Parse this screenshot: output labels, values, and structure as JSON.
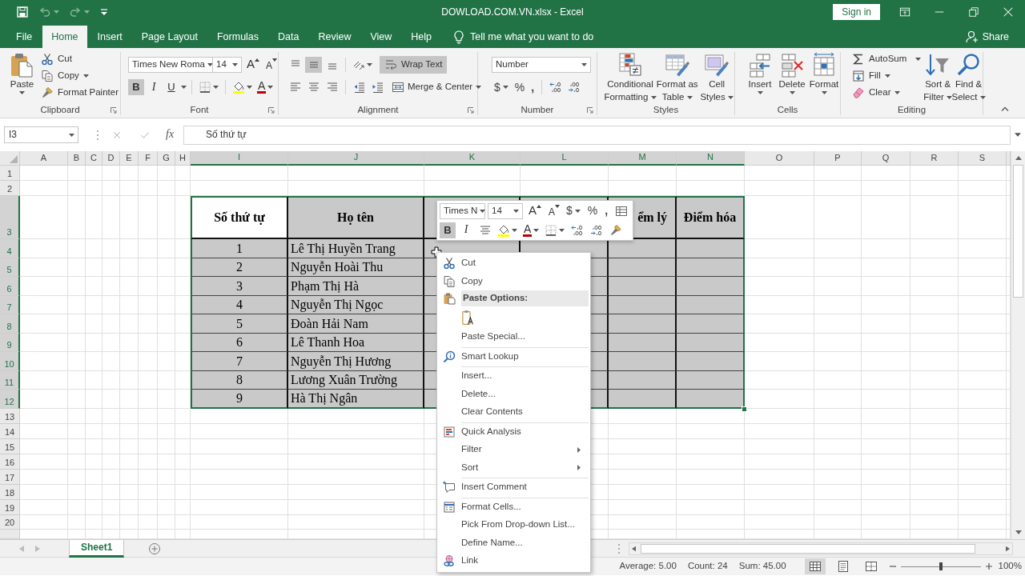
{
  "title_bar": {
    "quick_access": [
      {
        "disabled": false
      },
      {
        "disabled": true
      },
      {
        "disabled": true
      }
    ],
    "title": "DOWLOAD.COM.VN.xlsx - Excel",
    "sign_in": "Sign in"
  },
  "ribbon_tabs": [
    {
      "label": "File",
      "selected": false
    },
    {
      "label": "Home",
      "selected": true
    },
    {
      "label": "Insert",
      "selected": false
    },
    {
      "label": "Page Layout",
      "selected": false
    },
    {
      "label": "Formulas",
      "selected": false
    },
    {
      "label": "Data",
      "selected": false
    },
    {
      "label": "Review",
      "selected": false
    },
    {
      "label": "View",
      "selected": false
    },
    {
      "label": "Help",
      "selected": false
    }
  ],
  "tell_me": "Tell me what you want to do",
  "share": "Share",
  "ribbon": {
    "clipboard": {
      "label": "Clipboard",
      "paste": "Paste",
      "cut": "Cut",
      "copy": "Copy",
      "format_painter": "Format Painter"
    },
    "font": {
      "label": "Font",
      "font_name": "Times New Roma",
      "font_size": "14",
      "grow": "A",
      "shrink": "A",
      "styles": [
        {
          "label": "B",
          "selected": true
        },
        {
          "label": "I",
          "selected": false
        },
        {
          "label": "U",
          "selected": false
        }
      ],
      "font_color": "A"
    },
    "alignment": {
      "label": "Alignment",
      "vertical": [
        {
          "selected": false
        },
        {
          "selected": true
        },
        {
          "selected": false
        }
      ],
      "wrap_text": {
        "label": "Wrap Text",
        "selected": true
      },
      "horizontal": [
        {
          "selected": false
        },
        {
          "selected": false
        },
        {
          "selected": false
        }
      ],
      "merge": "Merge & Center"
    },
    "number": {
      "label": "Number",
      "format": "Number",
      "currency": "$",
      "percent": "%",
      "comma": ","
    },
    "styles": {
      "label": "Styles",
      "buttons": [
        [
          "Conditional",
          "Formatting"
        ],
        [
          "Format as",
          "Table"
        ],
        [
          "Cell",
          "Styles"
        ]
      ]
    },
    "cells": {
      "label": "Cells",
      "buttons": [
        "Insert",
        "Delete",
        "Format"
      ]
    },
    "editing": {
      "label": "Editing",
      "autosum": "AutoSum",
      "fill": "Fill",
      "clear": "Clear",
      "sort": [
        "Sort &",
        "Filter"
      ],
      "find": [
        "Find &",
        "Select"
      ]
    }
  },
  "formula_bar": {
    "name_box": "I3",
    "function_label": "fx",
    "formula": "Số thứ tự"
  },
  "sheet": {
    "columns": [
      {
        "label": "A",
        "selected": false
      },
      {
        "label": "B",
        "selected": false
      },
      {
        "label": "C",
        "selected": false
      },
      {
        "label": "D",
        "selected": false
      },
      {
        "label": "E",
        "selected": false
      },
      {
        "label": "F",
        "selected": false
      },
      {
        "label": "G",
        "selected": false
      },
      {
        "label": "H",
        "selected": false
      },
      {
        "label": "I",
        "selected": true
      },
      {
        "label": "J",
        "selected": true
      },
      {
        "label": "K",
        "selected": true
      },
      {
        "label": "L",
        "selected": true
      },
      {
        "label": "M",
        "selected": true
      },
      {
        "label": "N",
        "selected": true
      },
      {
        "label": "O",
        "selected": false
      },
      {
        "label": "P",
        "selected": false
      },
      {
        "label": "Q",
        "selected": false
      },
      {
        "label": "R",
        "selected": false
      },
      {
        "label": "S",
        "selected": false
      }
    ],
    "rows": [
      {
        "label": "1",
        "selected": false
      },
      {
        "label": "2",
        "selected": false
      },
      {
        "label": "3",
        "selected": true
      },
      {
        "label": "4",
        "selected": true
      },
      {
        "label": "5",
        "selected": true
      },
      {
        "label": "6",
        "selected": true
      },
      {
        "label": "7",
        "selected": true
      },
      {
        "label": "8",
        "selected": true
      },
      {
        "label": "9",
        "selected": true
      },
      {
        "label": "10",
        "selected": true
      },
      {
        "label": "11",
        "selected": true
      },
      {
        "label": "12",
        "selected": true
      },
      {
        "label": "13",
        "selected": false
      },
      {
        "label": "14",
        "selected": false
      },
      {
        "label": "15",
        "selected": false
      },
      {
        "label": "16",
        "selected": false
      },
      {
        "label": "17",
        "selected": false
      },
      {
        "label": "18",
        "selected": false
      },
      {
        "label": "19",
        "selected": false
      },
      {
        "label": "20",
        "selected": false
      }
    ]
  },
  "table": {
    "selected": true,
    "header": [
      {
        "text": "Số thứ tự",
        "active": true
      },
      {
        "text": "Họ tên",
        "active": false
      },
      {
        "active": false
      },
      {
        "active": false
      },
      {
        "text": "ểm lý",
        "active": false
      },
      {
        "text": "Điểm hóa",
        "active": false
      }
    ],
    "rows": [
      {
        "number": "1",
        "name": "Lê Thị Huyền Trang"
      },
      {
        "number": "2",
        "name": "Nguyễn Hoài Thu"
      },
      {
        "number": "3",
        "name": "Phạm Thị Hà"
      },
      {
        "number": "4",
        "name": "Nguyễn Thị Ngọc"
      },
      {
        "number": "5",
        "name": "Đoàn Hải Nam"
      },
      {
        "number": "6",
        "name": "Lê Thanh Hoa"
      },
      {
        "number": "7",
        "name": "Nguyễn Thị Hương"
      },
      {
        "number": "8",
        "name": "Lương Xuân Trường"
      },
      {
        "number": "9",
        "name": "Hà Thị Ngân"
      }
    ]
  },
  "mini_toolbar": {
    "font_name": "Times N",
    "font_size": "14",
    "grow": "A",
    "shrink": "A",
    "currency": "$",
    "percent": "%",
    "comma": ",",
    "styles": [
      {
        "label": "B",
        "selected": true
      },
      {
        "label": "I",
        "selected": false
      }
    ],
    "font_color": "A"
  },
  "context_menu": {
    "sections": [
      [
        {
          "kind": "item",
          "label": "Cut"
        },
        {
          "kind": "item",
          "label": "Copy"
        },
        {
          "kind": "heading",
          "label": "Paste Options:"
        },
        {
          "kind": "paste-options"
        },
        {
          "kind": "item",
          "label": "Paste Special..."
        }
      ],
      [
        {
          "kind": "item",
          "label": "Smart Lookup"
        }
      ],
      [
        {
          "kind": "item",
          "label": "Insert..."
        },
        {
          "kind": "item",
          "label": "Delete..."
        },
        {
          "kind": "item",
          "label": "Clear Contents"
        }
      ],
      [
        {
          "kind": "item",
          "label": "Quick Analysis"
        },
        {
          "kind": "submenu",
          "label": "Filter"
        },
        {
          "kind": "submenu",
          "label": "Sort"
        }
      ],
      [
        {
          "kind": "item",
          "label": "Insert Comment"
        }
      ],
      [
        {
          "kind": "item",
          "label": "Format Cells..."
        },
        {
          "kind": "item",
          "label": "Pick From Drop-down List..."
        },
        {
          "kind": "item",
          "label": "Define Name..."
        },
        {
          "kind": "item",
          "label": "Link"
        }
      ]
    ]
  },
  "sheet_tabs": [
    {
      "label": "Sheet1",
      "selected": true
    }
  ],
  "status_bar": {
    "stats": [
      "Average: 5.00",
      "Count: 24",
      "Sum: 45.00"
    ],
    "views": [
      {
        "selected": true
      },
      {
        "selected": false
      },
      {
        "selected": false
      }
    ],
    "zoom": {
      "level": 0.5,
      "reading": "100%"
    }
  }
}
